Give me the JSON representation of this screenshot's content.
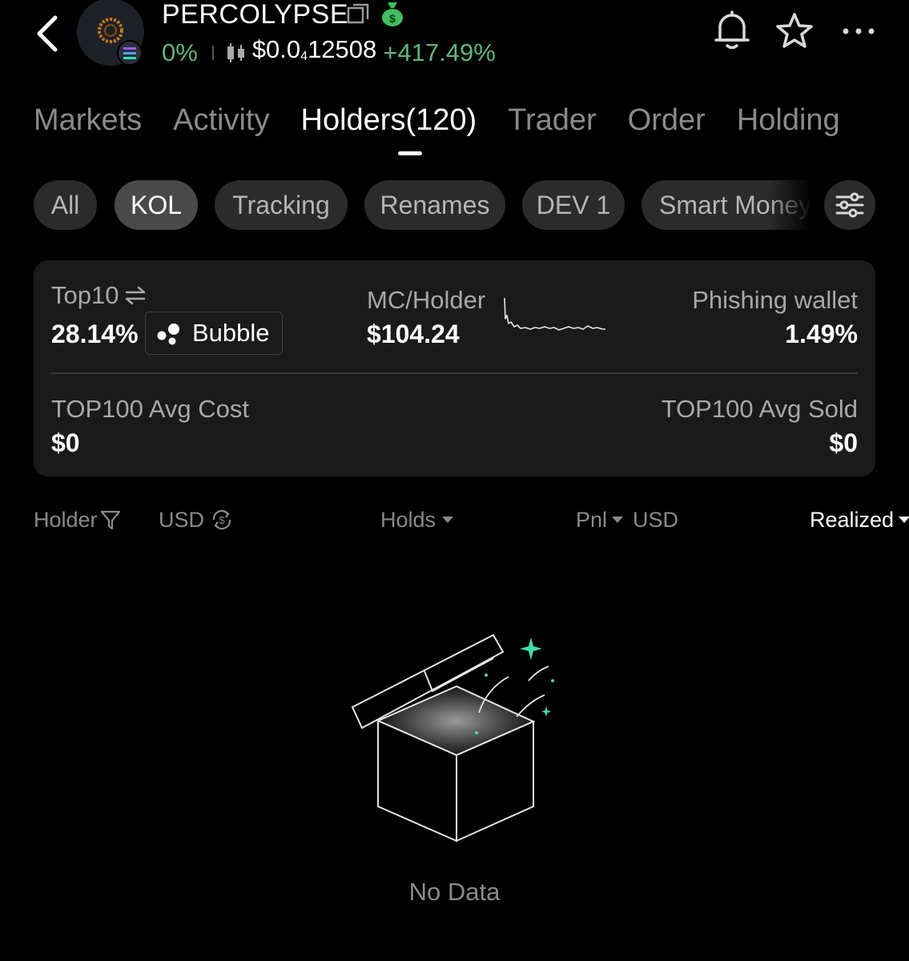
{
  "header": {
    "title": "PERCOLYPSE",
    "holders_change": "0%",
    "price_prefix": "$0.0",
    "price_zeros": "4",
    "price_suffix": "12508",
    "price_change": "+417.49%",
    "icons": [
      "back-icon",
      "token-avatar",
      "solana-badge-icon",
      "copy-icon",
      "money-bag-icon",
      "candlestick-icon",
      "bell-icon",
      "star-icon",
      "more-icon"
    ]
  },
  "tabs": [
    {
      "label": "Markets",
      "active": false
    },
    {
      "label": "Activity",
      "active": false
    },
    {
      "label": "Holders(120)",
      "active": true
    },
    {
      "label": "Trader",
      "active": false
    },
    {
      "label": "Order",
      "active": false
    },
    {
      "label": "Holding",
      "active": false
    }
  ],
  "chips": [
    {
      "label": "All",
      "active": false
    },
    {
      "label": "KOL",
      "active": true
    },
    {
      "label": "Tracking",
      "active": false
    },
    {
      "label": "Renames",
      "active": false
    },
    {
      "label": "DEV 1",
      "active": false
    },
    {
      "label": "Smart Money",
      "active": false
    }
  ],
  "stats": {
    "top10_label": "Top10",
    "top10_value": "28.14%",
    "bubble_label": "Bubble",
    "mc_holder_label": "MC/Holder",
    "mc_holder_value": "$104.24",
    "phishing_label": "Phishing wallet",
    "phishing_value": "1.49%",
    "avg_cost_label": "TOP100 Avg Cost",
    "avg_cost_value": "$0",
    "avg_sold_label": "TOP100 Avg Sold",
    "avg_sold_value": "$0"
  },
  "table_header": {
    "holder": "Holder",
    "usd": "USD",
    "holds": "Holds",
    "pnl": "Pnl",
    "pnl_usd": "USD",
    "realized": "Realized"
  },
  "empty_state": {
    "text": "No Data"
  },
  "colors": {
    "background": "#000000",
    "positive": "#5fb47a",
    "accent_sparkle": "#3fe0b0",
    "card": "#1a1a1a",
    "chip": "#2b2b2b",
    "chip_active": "#4a4a4a"
  }
}
